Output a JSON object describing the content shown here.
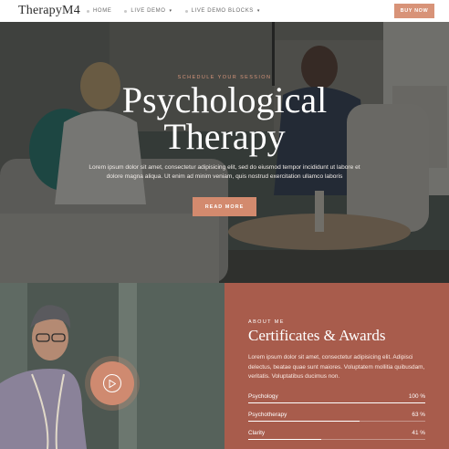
{
  "header": {
    "logo": "TherapyM4",
    "nav": [
      {
        "label": "HOME",
        "has_dropdown": false
      },
      {
        "label": "LIVE DEMO",
        "has_dropdown": true
      },
      {
        "label": "LIVE DEMO BLOCKS",
        "has_dropdown": true
      }
    ],
    "buy_label": "BUY NOW"
  },
  "hero": {
    "eyebrow": "SCHEDULE YOUR SESSION",
    "title_line1": "Psychological",
    "title_line2": "Therapy",
    "text": "Lorem ipsum dolor sit amet, consectetur adipisicing elit, sed do eiusmod tempor incididunt ut labore et dolore magna aliqua. Ut enim ad minim veniam, quis nostrud exercitation ullamco laboris",
    "button_label": "READ MORE"
  },
  "about": {
    "eyebrow": "ABOUT ME",
    "title": "Certificates & Awards",
    "text": "Lorem ipsum dolor sit amet, consectetur adipisicing elit. Adipisci delectus, beatae quae sunt maiores. Voluptatem mollitia quibusdam, veritatis. Voluptatibus ducimus non.",
    "skills": [
      {
        "label": "Psychology",
        "value": "100 %",
        "fraction": 1.0
      },
      {
        "label": "Psychotherapy",
        "value": "63 %",
        "fraction": 0.63
      },
      {
        "label": "Clarity",
        "value": "41 %",
        "fraction": 0.41
      }
    ]
  },
  "colors": {
    "accent": "#d89378",
    "about_bg": "#a85c4c",
    "hero_overlay": "#191c1b"
  },
  "icons": {
    "play": "play-icon",
    "dropdown": "chevron-down-icon"
  }
}
